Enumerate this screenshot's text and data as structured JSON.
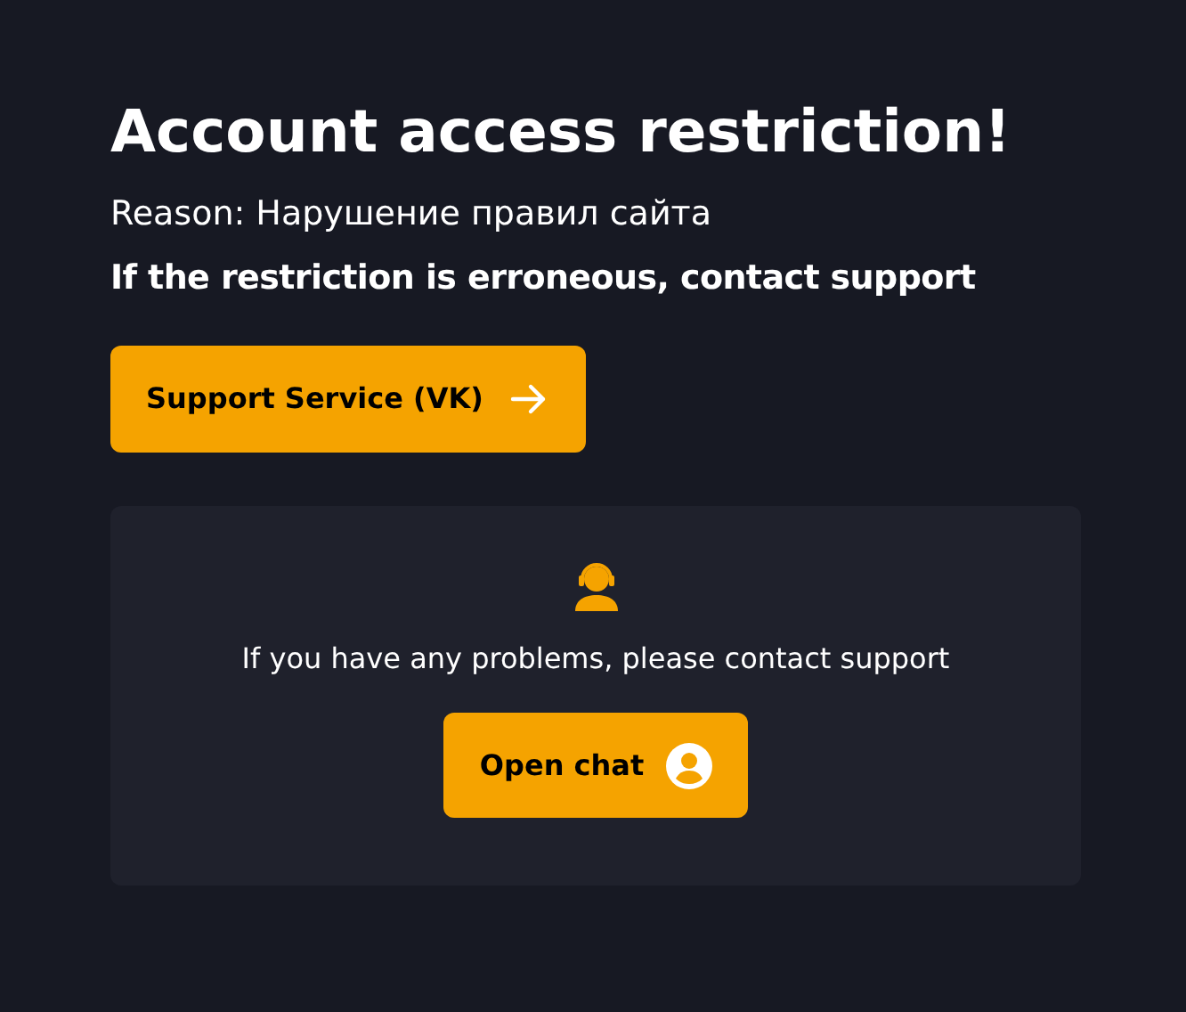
{
  "title": "Account access restriction!",
  "reason": "Reason: Нарушение правил сайта",
  "notice": "If the restriction is erroneous, contact support",
  "support_button": {
    "label": "Support Service (VK)"
  },
  "support_card": {
    "text": "If you have any problems, please contact support",
    "button": {
      "label": "Open chat"
    }
  }
}
